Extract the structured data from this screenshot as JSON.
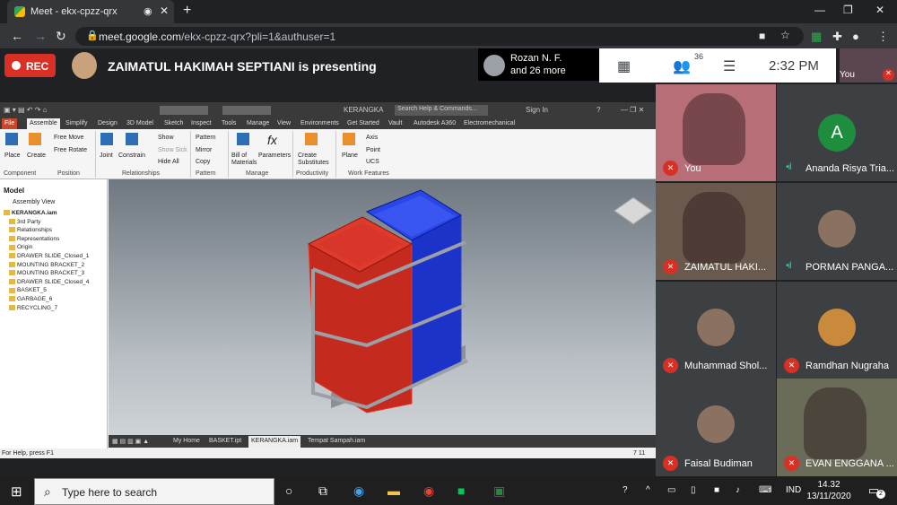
{
  "browser": {
    "tab_title": "Meet - ekx-cpzz-qrx",
    "url_domain": "meet.google.com",
    "url_path": "/ekx-cpzz-qrx?pli=1&authuser=1"
  },
  "meet": {
    "rec_label": "REC",
    "presenter_text": "ZAIMATUL HAKIMAH SEPTIANI is presenting",
    "share_name": "Rozan N. F.",
    "share_more": "and 26 more",
    "participant_count": "36",
    "time": "2:32 PM",
    "self_label": "You"
  },
  "inventor": {
    "doc_title": "KERANGKA",
    "search_placeholder": "Search Help & Commands...",
    "sign_in": "Sign In",
    "tabs": [
      "File",
      "Assemble",
      "Simplify",
      "Design",
      "3D Model",
      "Sketch",
      "Inspect",
      "Tools",
      "Manage",
      "View",
      "Environments",
      "Get Started",
      "Vault",
      "Autodesk A360",
      "Electromechanical"
    ],
    "ribbon": {
      "place": "Place",
      "create": "Create",
      "free_move": "Free Move",
      "free_rotate": "Free Rotate",
      "joint": "Joint",
      "constrain": "Constrain",
      "show": "Show",
      "show_sick": "Show Sick",
      "hide_all": "Hide All",
      "pattern": "Pattern",
      "mirror": "Mirror",
      "copy": "Copy",
      "bom": "Bill of Materials",
      "parameters": "Parameters",
      "create_subs": "Create Substitutes",
      "plane": "Plane",
      "axis": "Axis",
      "point": "Point",
      "ucs": "UCS",
      "groups": {
        "component": "Component",
        "position": "Position",
        "relationships": "Relationships",
        "pattern": "Pattern",
        "manage": "Manage",
        "productivity": "Productivity",
        "work_features": "Work Features"
      }
    },
    "model_header": "Model",
    "assembly_view": "Assembly View",
    "tree": [
      "KERANGKA.iam",
      "3rd Party",
      "Relationships",
      "Representations",
      "Origin",
      "DRAWER SLIDE_Closed_1",
      "MOUNTING BRACKET_2",
      "MOUNTING BRACKET_3",
      "DRAWER SLIDE_Closed_4",
      "BASKET_5",
      "GARBAGE_6",
      "RECYCLING_7"
    ],
    "doc_tabs": [
      "My Home",
      "BASKET.ipt",
      "KERANGKA.iam",
      "Tempat Sampah.iam"
    ],
    "status_left": "For Help, press F1",
    "status_right": "7    11"
  },
  "participants": [
    {
      "name": "You",
      "muted": true
    },
    {
      "name": "Ananda Risya Tria...",
      "muted": false,
      "initial": "A",
      "color": "#1e8e3e"
    },
    {
      "name": "ZAIMATUL HAKI...",
      "muted": true
    },
    {
      "name": "PORMAN PANGA...",
      "muted": false
    },
    {
      "name": "Muhammad Shol...",
      "muted": true
    },
    {
      "name": "Ramdhan Nugraha",
      "muted": true
    },
    {
      "name": "Faisal Budiman",
      "muted": true
    },
    {
      "name": "EVAN ENGGANA ...",
      "muted": true
    }
  ],
  "taskbar": {
    "search_placeholder": "Type here to search",
    "lang": "IND",
    "time": "14.32",
    "date": "13/11/2020",
    "notif_count": "2"
  }
}
